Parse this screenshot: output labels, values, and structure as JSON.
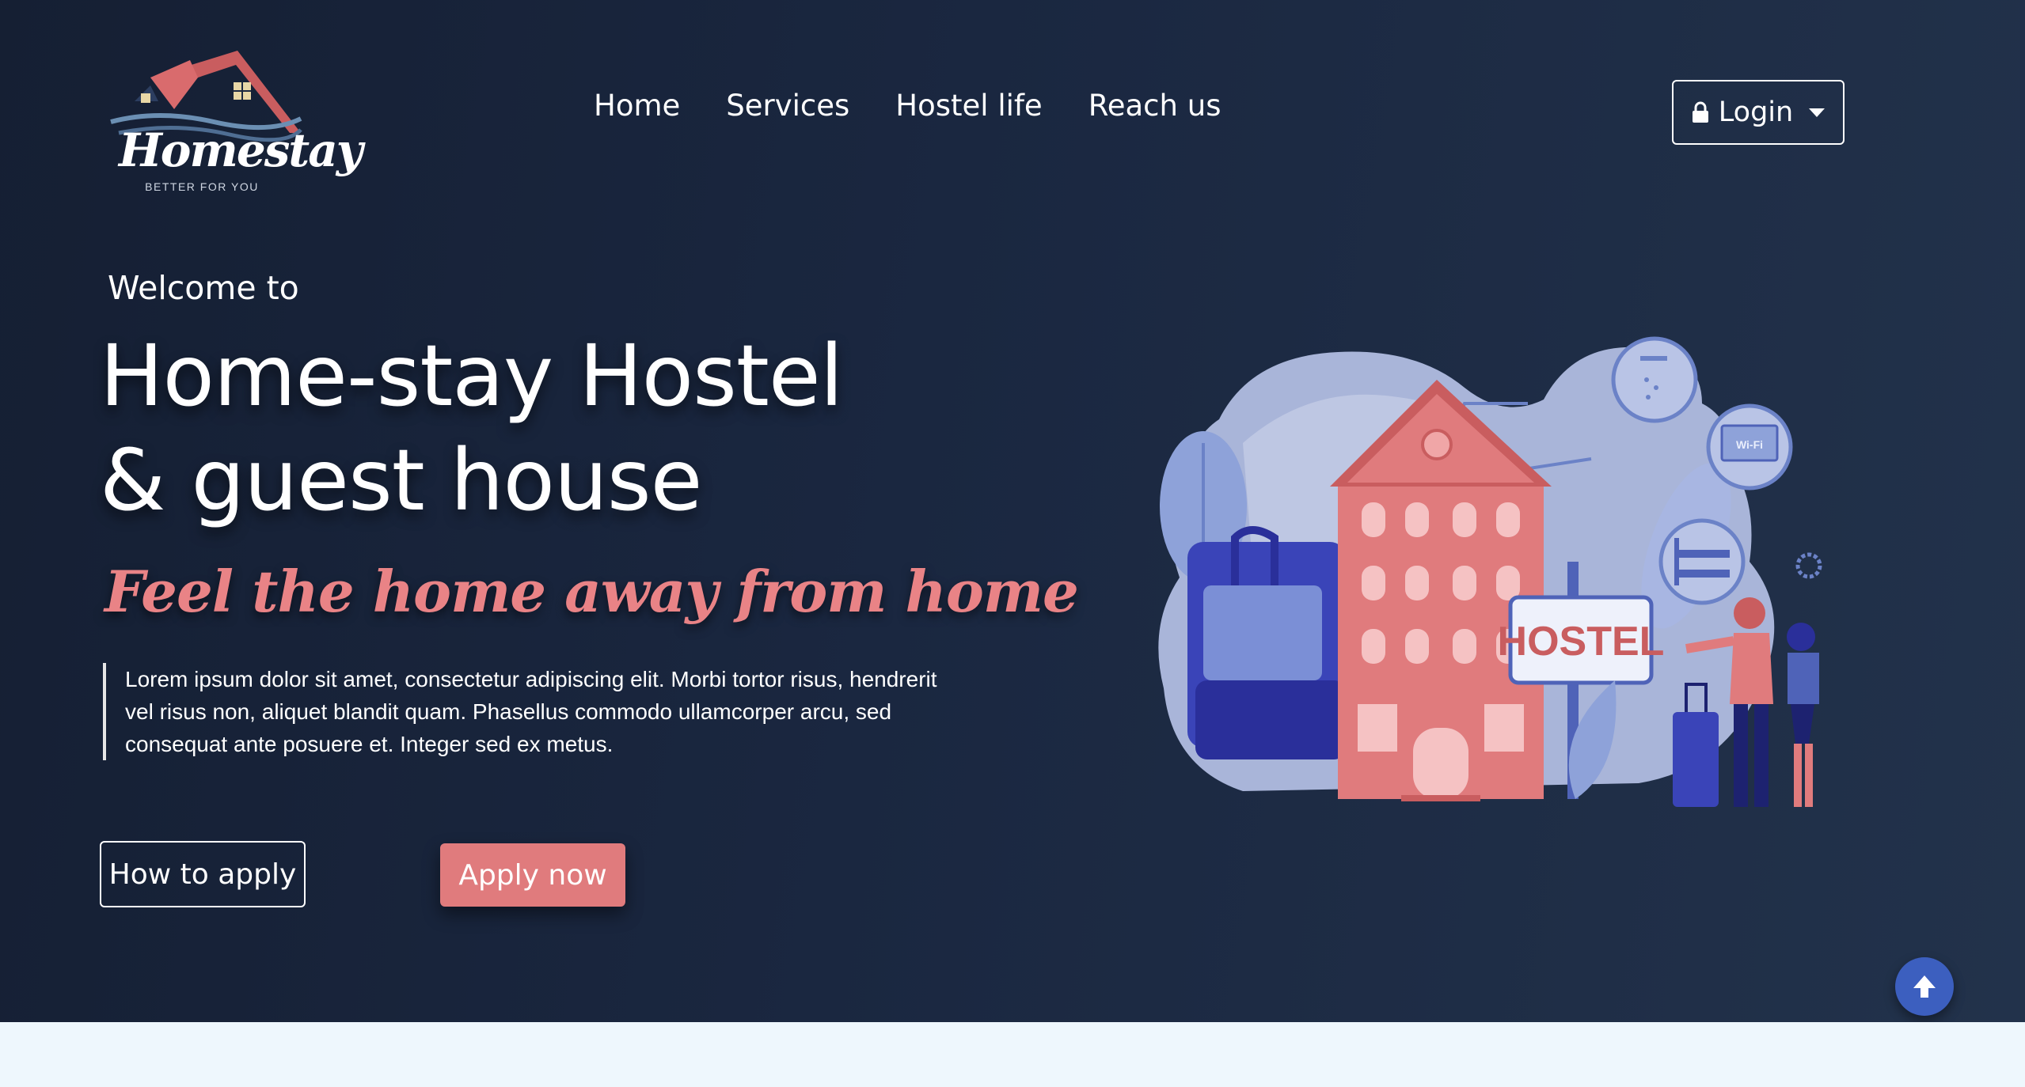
{
  "brand": {
    "logo_word": "Homestay",
    "logo_tagline": "BETTER FOR YOU"
  },
  "nav": {
    "links": [
      "Home",
      "Services",
      "Hostel life",
      "Reach us"
    ],
    "login_label": "Login"
  },
  "hero": {
    "welcome": "Welcome to",
    "title_line1": "Home-stay Hostel",
    "title_line2": "& guest house",
    "tagline": "Feel the home away from home",
    "description": "Lorem ipsum dolor sit amet, consectetur adipiscing elit. Morbi tortor risus, hendrerit vel risus non, aliquet blandit quam. Phasellus commodo ullamcorper arcu, sed consequat ante posuere et. Integer sed ex metus.",
    "how_to_apply_label": "How to apply",
    "apply_now_label": "Apply now"
  },
  "illustration": {
    "sign_text": "HOSTEL",
    "wifi_text": "Wi-Fi"
  },
  "icons": {
    "login": "lock-icon",
    "dropdown": "caret-down-icon",
    "scroll_top": "arrow-up-icon"
  },
  "colors": {
    "hero_bg": "#1a2740",
    "accent": "#e07b7d",
    "scroll_button": "#3c5fbf",
    "page_bg": "#eef7fd"
  }
}
